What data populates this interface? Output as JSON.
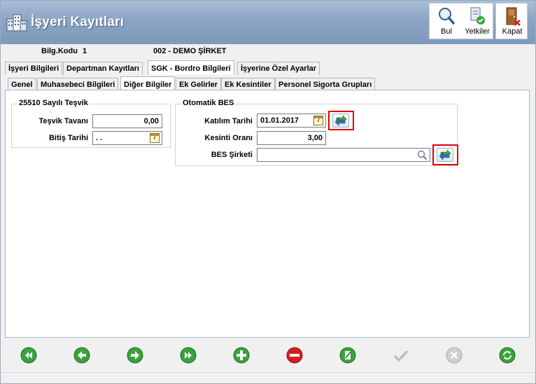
{
  "window": {
    "title": "İşyeri Kayıtları"
  },
  "toolbar": {
    "find_label": "Bul",
    "permissions_label": "Yetkiler",
    "close_label": "Kapat"
  },
  "info": {
    "code_label": "Bilg.Kodu",
    "code_value": "1",
    "company_value": "002 - DEMO ŞİRKET"
  },
  "main_tabs": [
    "İşyeri Bilgileri",
    "Departman Kayıtları",
    "SGK - Bordro Bilgileri",
    "İşyerine Özel Ayarlar"
  ],
  "sub_tabs": [
    "Genel",
    "Muhasebeci Bilgileri",
    "Diğer Bilgiler",
    "Ek Gelirler",
    "Ek Kesintiler",
    "Personel Sigorta Grupları"
  ],
  "tesvik": {
    "group_title": "25510 Sayılı Teşvik",
    "ceiling_label": "Teşvik Tavanı",
    "ceiling_value": "0,00",
    "end_date_label": "Bitiş Tarihi",
    "end_date_value": ". ."
  },
  "bes": {
    "group_title": "Otomatik BES",
    "join_date_label": "Katılım Tarihi",
    "join_date_value": "01.01.2017",
    "deduction_label": "Kesinti Oranı",
    "deduction_value": "3,00",
    "company_label": "BES Şirketi",
    "company_value": ""
  },
  "colors": {
    "title_gradient_top": "#aabed6",
    "title_gradient_bottom": "#7d99bb",
    "nav_green": "#3aa23a",
    "delete_red": "#d42020",
    "highlight_red": "#e00000"
  }
}
